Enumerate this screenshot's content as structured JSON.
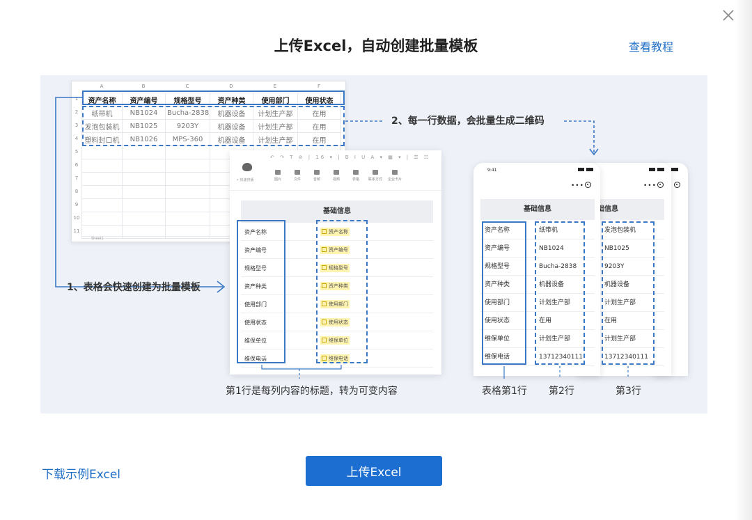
{
  "dialog": {
    "title": "上传Excel，自动创建批量模板",
    "tutorial_link": "查看教程",
    "close_icon": "close-icon"
  },
  "illustration": {
    "spreadsheet": {
      "column_letters": [
        "A",
        "B",
        "C",
        "D",
        "E",
        "F"
      ],
      "row_numbers": [
        "1",
        "2",
        "3",
        "4",
        "5",
        "6",
        "7",
        "8",
        "9",
        "10",
        "11"
      ],
      "headers": [
        "资产名称",
        "资产编号",
        "规格型号",
        "资产种类",
        "使用部门",
        "使用状态"
      ],
      "rows": [
        [
          "纸带机",
          "NB1024",
          "Bucha-2838",
          "机器设备",
          "计划生产部",
          "在用"
        ],
        [
          "发泡包装机",
          "NB1025",
          "9203Y",
          "机器设备",
          "计划生产部",
          "在用"
        ],
        [
          "塑料封口机",
          "NB1026",
          "MPS-360",
          "机器设备",
          "计划生产部",
          "在用"
        ]
      ],
      "sheet_tab": "Sheet1"
    },
    "note_1": "1、表格会快速创建为批量模板",
    "note_2": "2、每一行数据，会批量生成二维码",
    "editor": {
      "logo_caption": "• 快速排版",
      "toolbar_row": "↶ ↷ T ⊘ | 16 ▾ | B I U A ▾ ▦ ▾ | ☰ ☷",
      "tools": [
        "图片",
        "文件",
        "音频",
        "视频",
        "表格",
        "联系方式",
        "企业卡片"
      ],
      "section_title": "基础信息",
      "field_labels": [
        "资产名称",
        "资产编号",
        "规格型号",
        "资产种类",
        "使用部门",
        "使用状态",
        "维保单位",
        "维保电话"
      ],
      "field_chips": [
        "资产名称",
        "资产编号",
        "规格型号",
        "资产种类",
        "使用部门",
        "使用状态",
        "维保单位",
        "维保电话"
      ]
    },
    "phone_1": {
      "time": "9:41",
      "section_title": "基础信息",
      "labels": [
        "资产名称",
        "资产编号",
        "规格型号",
        "资产种类",
        "使用部门",
        "使用状态",
        "维保单位",
        "维保电话"
      ],
      "values": [
        "纸带机",
        "NB1024",
        "Bucha-2838",
        "机器设备",
        "计划生产部",
        "在用",
        "计划生产部",
        "13712340111"
      ]
    },
    "phone_2": {
      "section_title": "基础信息",
      "values": [
        "发泡包装机",
        "NB1025",
        "9203Y",
        "机器设备",
        "计划生产部",
        "在用",
        "计划生产部",
        "13712340111"
      ]
    },
    "captions": {
      "editor": "第1行是每列内容的标题，转为可变内容",
      "row1": "表格第1行",
      "row2": "第2行",
      "row3": "第3行"
    }
  },
  "footer": {
    "download_link": "下载示例Excel",
    "upload_button": "上传Excel"
  },
  "colors": {
    "accent": "#1c6ed0",
    "link": "#1f6fc5",
    "highlight": "#3a78c5",
    "chip": "#fff3b0"
  }
}
